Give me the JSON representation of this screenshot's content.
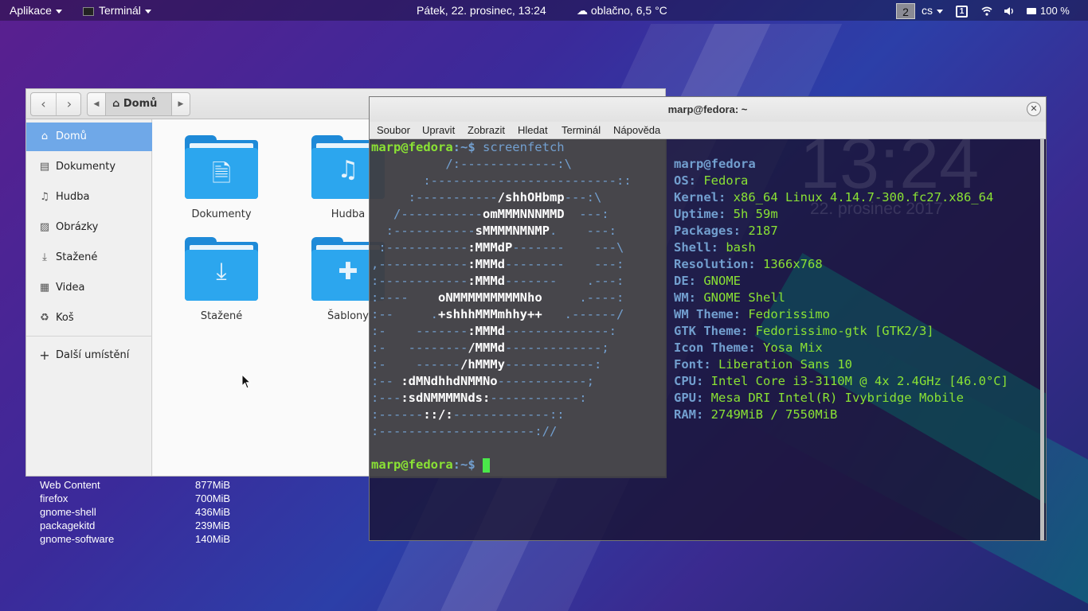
{
  "topbar": {
    "apps_label": "Aplikace",
    "active_app": "Terminál",
    "datetime": "Pátek, 22. prosinec, 13:24",
    "weather": "oblačno, 6,5 °C",
    "workspace": "2",
    "keyboard_layout": "cs",
    "input_indicator": "1",
    "battery": "100 %"
  },
  "filemanager": {
    "path_home": "Domů",
    "sidebar": [
      {
        "label": "Domů",
        "icon": "home-icon"
      },
      {
        "label": "Dokumenty",
        "icon": "document-icon"
      },
      {
        "label": "Hudba",
        "icon": "music-icon"
      },
      {
        "label": "Obrázky",
        "icon": "image-icon"
      },
      {
        "label": "Stažené",
        "icon": "download-icon"
      },
      {
        "label": "Videa",
        "icon": "video-icon"
      },
      {
        "label": "Koš",
        "icon": "trash-icon"
      },
      {
        "label": "Další umístění",
        "icon": "plus-icon"
      }
    ],
    "folders": [
      {
        "label": "Dokumenty",
        "icon": "document-icon"
      },
      {
        "label": "Hudba",
        "icon": "music-icon"
      },
      {
        "label": "Stažené",
        "icon": "download-icon"
      },
      {
        "label": "Šablony",
        "icon": "puzzle-icon"
      }
    ]
  },
  "processes": [
    {
      "name": "Web Content",
      "mem": "877MiB"
    },
    {
      "name": "firefox",
      "mem": "700MiB"
    },
    {
      "name": "gnome-shell",
      "mem": "436MiB"
    },
    {
      "name": "packagekitd",
      "mem": "239MiB"
    },
    {
      "name": "gnome-software",
      "mem": "140MiB"
    }
  ],
  "terminal": {
    "title": "marp@fedora: ~",
    "menu": [
      "Soubor",
      "Upravit",
      "Zobrazit",
      "Hledat",
      "Terminál",
      "Nápověda"
    ],
    "prompt_user": "marp@fedora",
    "prompt_path": ":~$ ",
    "command": "screenfetch",
    "ghost_clock": "13:24",
    "ghost_date": "22. prosinec 2017",
    "logo_lines": [
      [
        "          /:",
        "",
        "-------------:\\"
      ],
      [
        "       :-------------------------::",
        "",
        ""
      ],
      [
        "     :-----------",
        "/shhOHbmp",
        "---:\\"
      ],
      [
        "   /-----------",
        "omMMMNNNMMD",
        "  ---:"
      ],
      [
        "  :-----------",
        "sMMMMNMNMP",
        ".    ---:"
      ],
      [
        " :-----------",
        ":MMMdP",
        "-------    ---\\"
      ],
      [
        ",------------",
        ":MMMd",
        "--------    ---:"
      ],
      [
        ":------------",
        ":MMMd",
        "-------    .---:"
      ],
      [
        ":----    ",
        "oNMMMMMMMMMNho",
        "     .----:"
      ],
      [
        ":--     .",
        "+shhhMMMmhhy++",
        "   .------/"
      ],
      [
        ":-    -------",
        ":MMMd",
        "--------------:"
      ],
      [
        ":-   --------",
        "/MMMd",
        "-------------;"
      ],
      [
        ":-    ------",
        "/hMMMy",
        "------------:"
      ],
      [
        ":-- ",
        ":dMNdhhdNMMNo",
        "------------;"
      ],
      [
        ":---",
        ":sdNMMMMNds:",
        "------------:"
      ],
      [
        ":------",
        "::/:",
        "-------------::"
      ],
      [
        ":---------------------://",
        "",
        ""
      ]
    ],
    "info": [
      {
        "key": "",
        "value": "marp@fedora"
      },
      {
        "key": "OS:",
        "value": "Fedora"
      },
      {
        "key": "Kernel:",
        "value": "x86_64 Linux 4.14.7-300.fc27.x86_64"
      },
      {
        "key": "Uptime:",
        "value": "5h 59m"
      },
      {
        "key": "Packages:",
        "value": "2187"
      },
      {
        "key": "Shell:",
        "value": "bash"
      },
      {
        "key": "Resolution:",
        "value": "1366x768"
      },
      {
        "key": "DE:",
        "value": "GNOME"
      },
      {
        "key": "WM:",
        "value": "GNOME Shell"
      },
      {
        "key": "WM Theme:",
        "value": "Fedorissimo"
      },
      {
        "key": "GTK Theme:",
        "value": "Fedorissimo-gtk [GTK2/3]"
      },
      {
        "key": "Icon Theme:",
        "value": "Yosa Mix"
      },
      {
        "key": "Font:",
        "value": "Liberation Sans 10"
      },
      {
        "key": "CPU:",
        "value": "Intel Core i3-3110M @ 4x 2.4GHz [46.0°C]"
      },
      {
        "key": "GPU:",
        "value": "Mesa DRI Intel(R) Ivybridge Mobile"
      },
      {
        "key": "RAM:",
        "value": "2749MiB / 7550MiB"
      }
    ]
  },
  "colors": {
    "accent": "#6fa8e8",
    "folder": "#2ca6ee",
    "term_green": "#8ae234",
    "term_blue": "#729fcf"
  }
}
